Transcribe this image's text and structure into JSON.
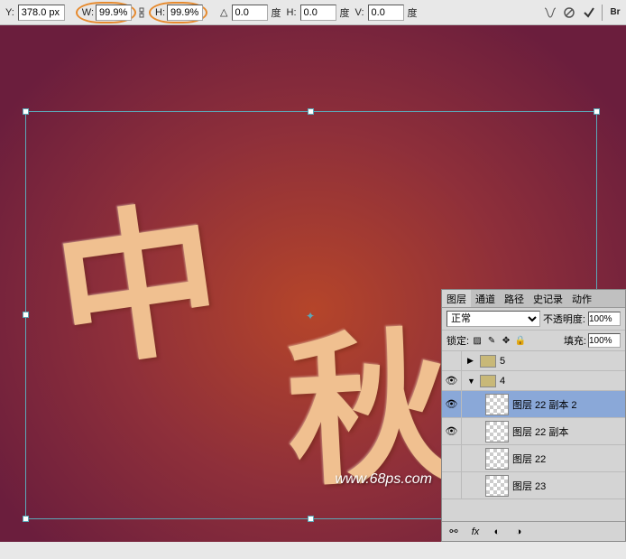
{
  "options": {
    "y_label": "Y:",
    "y_value": "378.0 px",
    "w_label": "W:",
    "w_value": "99.9%",
    "h_label": "H:",
    "h_value": "99.9%",
    "angle_label": "△",
    "angle_value": "0.0",
    "angle_unit": "度",
    "hskew_label": "H:",
    "hskew_value": "0.0",
    "hskew_unit": "度",
    "vskew_label": "V:",
    "vskew_value": "0.0",
    "vskew_unit": "度"
  },
  "canvas": {
    "art_char1": "中",
    "art_char2": "秋",
    "watermark": "www.68ps.com"
  },
  "layers_panel": {
    "tabs": {
      "layers": "图层",
      "channels": "通道",
      "paths": "路径",
      "history": "史记录",
      "actions": "动作"
    },
    "blend_mode": "正常",
    "opacity_label": "不透明度:",
    "opacity_value": "100%",
    "lock_label": "锁定:",
    "fill_label": "填充:",
    "fill_value": "100%",
    "groups": {
      "g5": "5",
      "g4": "4"
    },
    "layers": [
      {
        "name": "图层 22 副本 2",
        "selected": true
      },
      {
        "name": "图层 22 副本",
        "selected": false
      },
      {
        "name": "图层 22",
        "selected": false
      },
      {
        "name": "图层 23",
        "selected": false
      }
    ]
  }
}
